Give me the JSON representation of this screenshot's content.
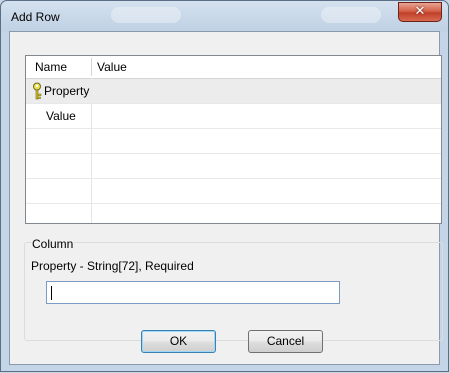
{
  "window": {
    "title": "Add Row",
    "close_glyph": "✕"
  },
  "grid": {
    "columns": [
      "Name",
      "Value"
    ],
    "rows": [
      {
        "name": "Property",
        "value": "",
        "icon": "key-icon",
        "selected": true
      },
      {
        "name": "Value",
        "value": "",
        "selected": false
      },
      {
        "name": "",
        "value": ""
      },
      {
        "name": "",
        "value": ""
      },
      {
        "name": "",
        "value": ""
      },
      {
        "name": "",
        "value": ""
      }
    ]
  },
  "column_group": {
    "title": "Column",
    "description": "Property - String[72], Required",
    "input_value": ""
  },
  "buttons": {
    "ok": "OK",
    "cancel": "Cancel"
  },
  "colors": {
    "selected_row": "#ececec",
    "key_icon": "#d8c21e"
  }
}
